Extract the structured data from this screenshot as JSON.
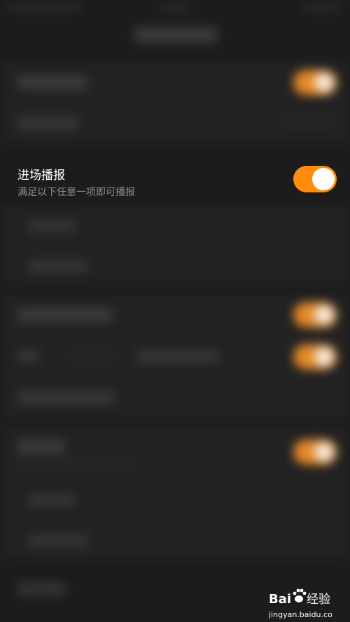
{
  "setting": {
    "title": "进场播报",
    "subtitle": "满足以下任意一项即可播报",
    "enabled": true
  },
  "watermark": {
    "brand": "Bai",
    "brand_suffix": "经验",
    "domain": "jingyan.baidu.com"
  },
  "colors": {
    "background": "#1c1c1d",
    "accent": "#ff8c0d",
    "title": "#ffffff",
    "subtitle": "#8e8e90"
  }
}
